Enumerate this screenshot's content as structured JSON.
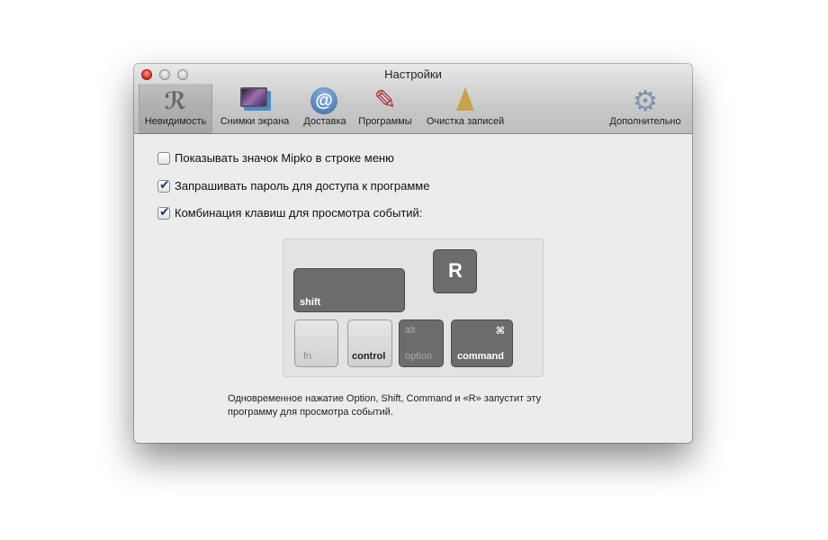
{
  "window": {
    "title": "Настройки"
  },
  "toolbar": {
    "items": [
      {
        "label": "Невидимость",
        "icon": "eye-of-horus-icon",
        "selected": true
      },
      {
        "label": "Снимки экрана",
        "icon": "screenshots-icon"
      },
      {
        "label": "Доставка",
        "icon": "at-sign-icon"
      },
      {
        "label": "Программы",
        "icon": "applications-icon"
      },
      {
        "label": "Очистка записей",
        "icon": "broom-icon"
      },
      {
        "label": "Дополнительно",
        "icon": "gear-icon"
      }
    ]
  },
  "options": [
    {
      "label": "Показывать значок Mipko в строке меню",
      "checked": false
    },
    {
      "label": "Запрашивать пароль для доступа к программе",
      "checked": true
    },
    {
      "label": "Комбинация клавиш для просмотра событий:",
      "checked": true
    }
  ],
  "keys": {
    "shift": "shift",
    "r": "R",
    "fn": "fn",
    "control": "control",
    "alt": "alt",
    "option": "option",
    "command_symbol": "⌘",
    "command": "command"
  },
  "note": "Одновременное нажатие Option, Shift, Command и «R» запустит эту программу для просмотра событий."
}
